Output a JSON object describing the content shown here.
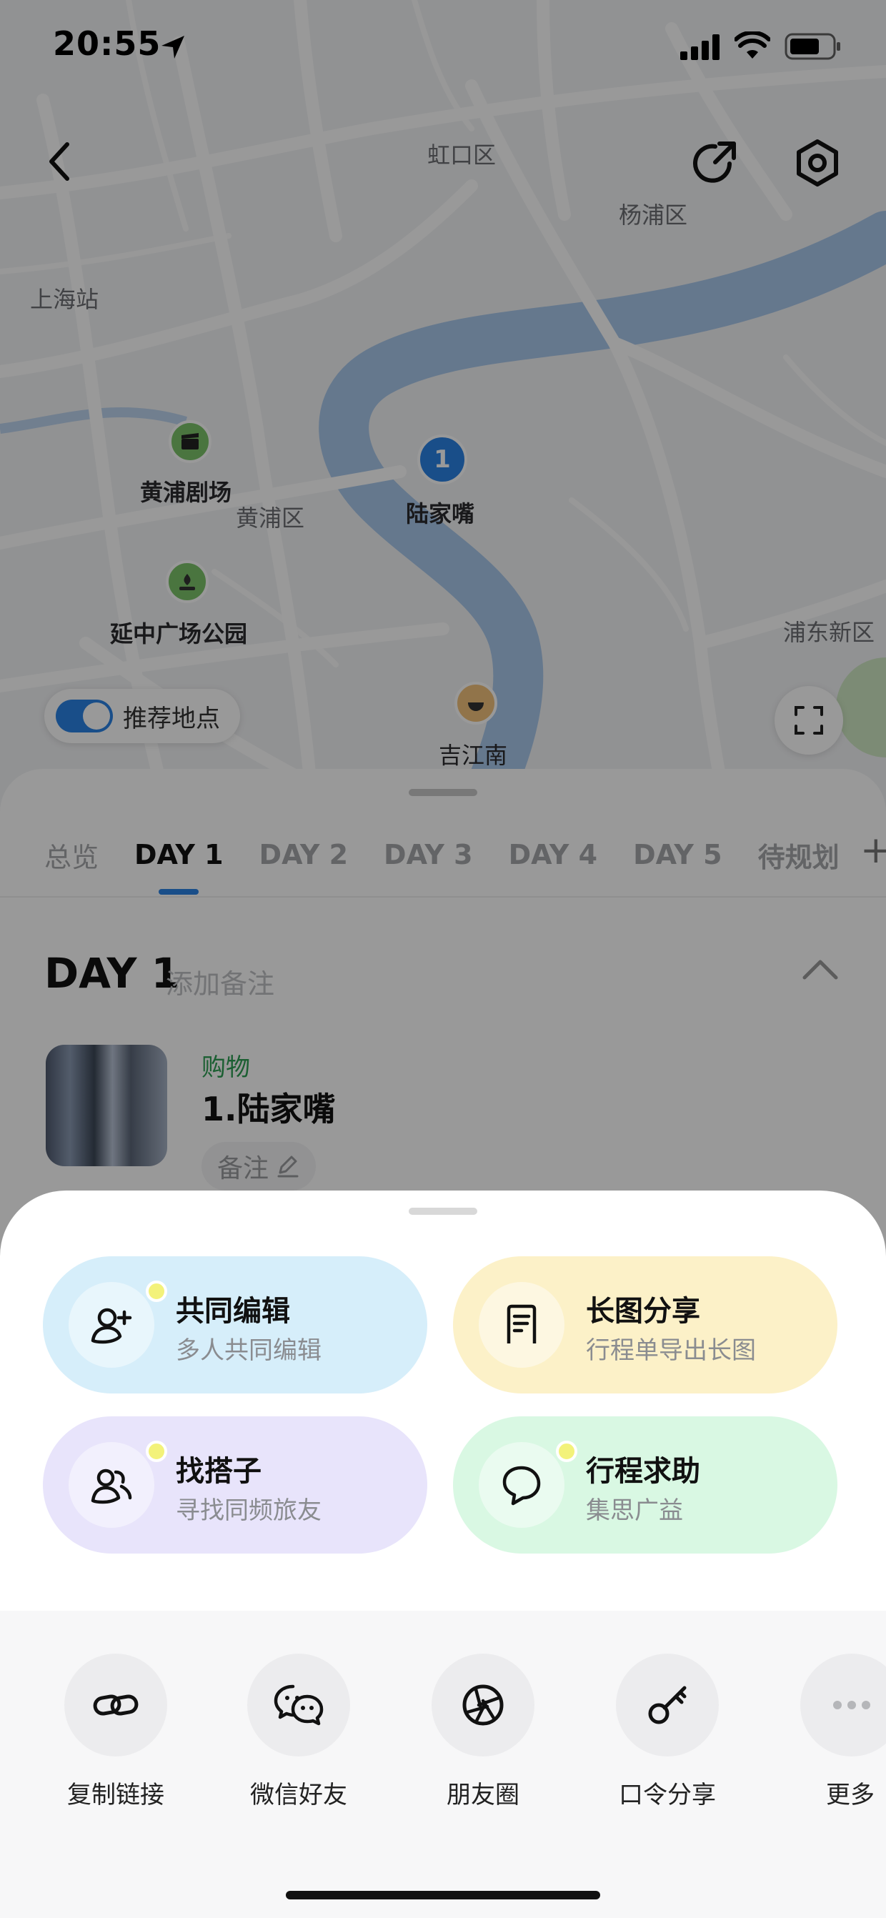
{
  "status_bar": {
    "time": "20:55"
  },
  "map": {
    "district_labels": [
      "虹口区",
      "杨浦区",
      "上海站",
      "黄浦区",
      "浦东新区"
    ],
    "pois": [
      {
        "name": "黄浦剧场",
        "icon": "clapperboard-icon"
      },
      {
        "name": "延中广场公园",
        "icon": "fountain-icon"
      },
      {
        "name": "陆家嘴",
        "icon": "number-pin-icon",
        "number": "1"
      },
      {
        "name": "吉江南",
        "icon": "food-bowl-icon"
      }
    ],
    "recommend_toggle": {
      "label": "推荐地点",
      "on": true
    }
  },
  "itinerary": {
    "tabs": [
      "总览",
      "DAY 1",
      "DAY 2",
      "DAY 3",
      "DAY 4",
      "DAY 5",
      "待规划"
    ],
    "active_tab": "DAY 1",
    "add_tab": "+",
    "day_title": "DAY 1",
    "day_note_placeholder": "添加备注",
    "place": {
      "category": "购物",
      "name": "1.陆家嘴",
      "remark": "备注"
    }
  },
  "share_sheet": {
    "actions": [
      {
        "title": "共同编辑",
        "subtitle": "多人共同编辑",
        "color": "#d6eefa",
        "icon": "add-user-icon",
        "dot": true
      },
      {
        "title": "长图分享",
        "subtitle": "行程单导出长图",
        "color": "#fcf1c8",
        "icon": "document-icon",
        "dot": false
      },
      {
        "title": "找搭子",
        "subtitle": "寻找同频旅友",
        "color": "#e8e4fb",
        "icon": "companions-icon",
        "dot": true
      },
      {
        "title": "行程求助",
        "subtitle": "集思广益",
        "color": "#d9f8e3",
        "icon": "chat-bubble-icon",
        "dot": true
      }
    ],
    "share_targets": [
      {
        "label": "复制链接",
        "icon": "link-icon"
      },
      {
        "label": "微信好友",
        "icon": "wechat-icon"
      },
      {
        "label": "朋友圈",
        "icon": "moments-icon"
      },
      {
        "label": "口令分享",
        "icon": "key-icon"
      },
      {
        "label": "更多",
        "icon": "more-icon"
      }
    ]
  },
  "colors": {
    "accent": "#2a82e4",
    "river": "#a9c8ec",
    "road": "#ffffff"
  }
}
